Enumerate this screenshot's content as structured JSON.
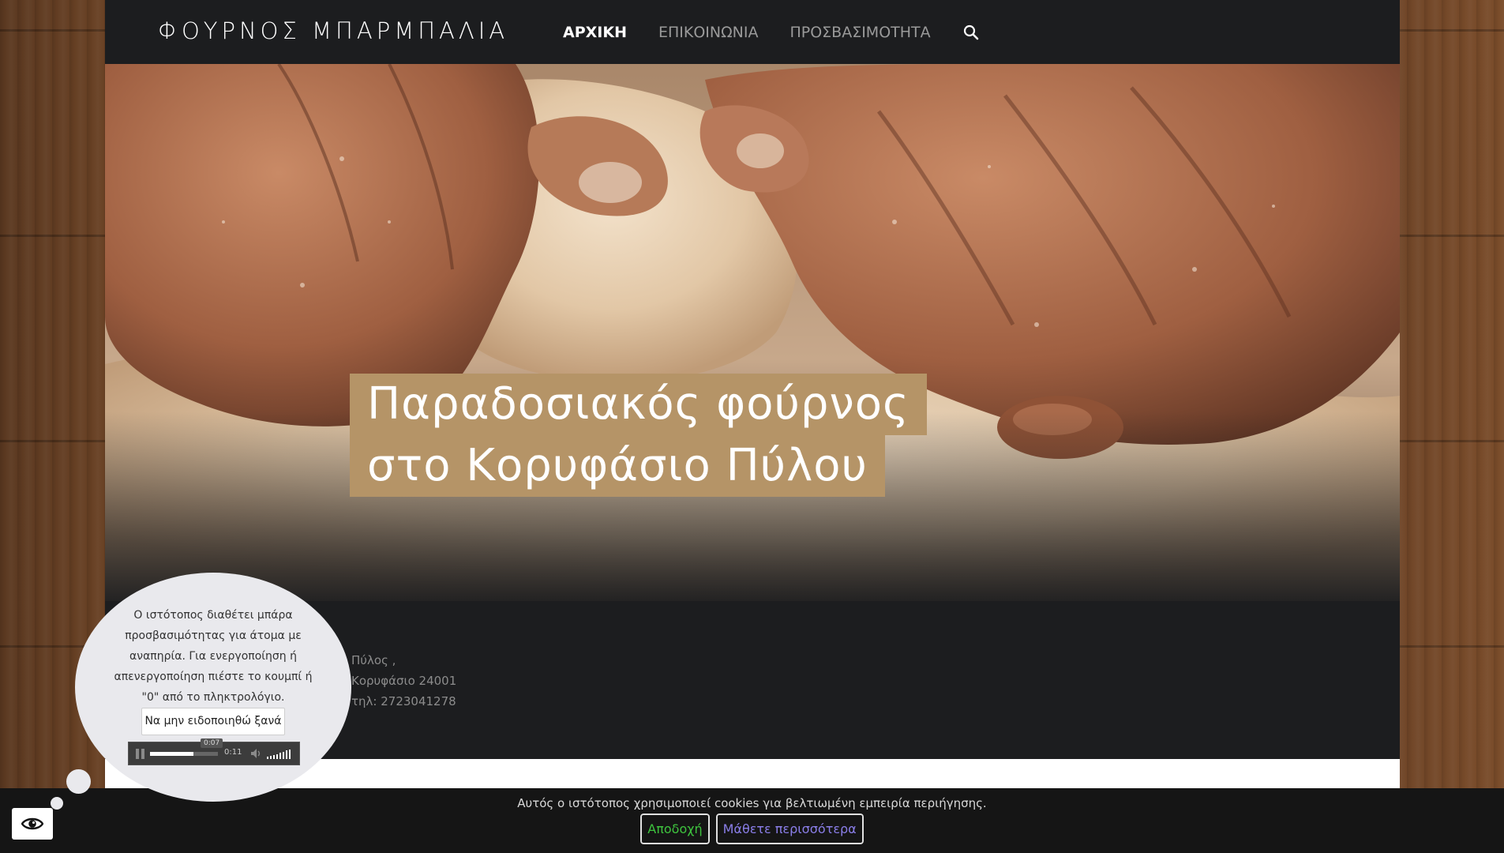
{
  "header": {
    "brand": "ΦΟΥΡΝΟΣ ΜΠΑΡΜΠΑΛΙΑ",
    "nav": [
      {
        "label": "ΑΡΧΙΚΗ",
        "active": true
      },
      {
        "label": "ΕΠΙΚΟΙΝΩΝΙΑ",
        "active": false
      },
      {
        "label": "ΠΡΟΣΒΑΣΙΜΟΤΗΤΑ",
        "active": false
      }
    ],
    "search_icon": "search-icon"
  },
  "hero": {
    "caption_line1": "Παραδοσιακός φούρνος",
    "caption_line2": "στο Κορυφάσιο Πύλου"
  },
  "footer": {
    "address_line1": "Πύλος ,",
    "address_line2": "Κορυφάσιο 24001",
    "phone": "τηλ: 2723041278"
  },
  "accessibility_popup": {
    "message": "Ο ιστότοπος διαθέτει μπάρα προσβασιμότητας για άτομα με αναπηρία. Για ενεργοποίηση ή απενεργοποίηση πιέστε το κουμπί ή \"0\" από το πληκτρολόγιο.",
    "dismiss_label": "Να μην ειδοποιηθώ ξανά",
    "audio": {
      "current_tooltip": "0:07",
      "duration": "0:11",
      "progress_fraction": 0.64
    },
    "toggle_icon": "eye-icon"
  },
  "cookie_bar": {
    "text": "Αυτός ο ιστότοπος χρησιμοποιεί cookies για βελτιωμένη εμπειρία περιήγησης.",
    "accept_label": "Αποδοχή",
    "more_label": "Μάθετε περισσότερα"
  },
  "colors": {
    "nav_bg": "#1c1d1f",
    "caption_bg": "#b59467",
    "accept": "#3ec43e",
    "more": "#8a7ee8"
  }
}
